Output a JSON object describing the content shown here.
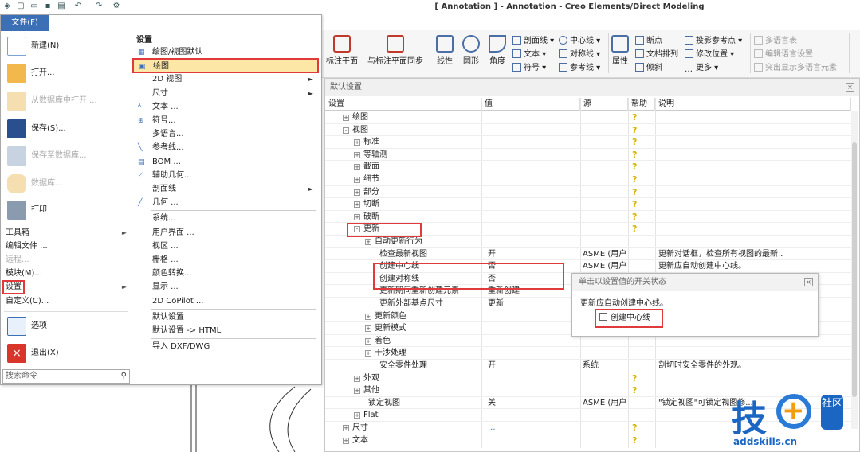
{
  "window": {
    "title": "[ Annotation ] - Annotation - Creo Elements/Direct Modeling"
  },
  "quick_access": [
    "new-icon",
    "open-icon",
    "save-icon",
    "print-icon",
    "undo-icon",
    "redo-icon",
    "options-icon"
  ],
  "file_menu": {
    "tab_label": "文件(F)",
    "big_items": [
      {
        "label": "新建(N)",
        "icon": "new-document-icon",
        "enabled": true
      },
      {
        "label": "打开...",
        "icon": "open-folder-icon",
        "enabled": true
      },
      {
        "label": "从数据库中打开 ...",
        "icon": "db-open-icon",
        "enabled": false
      },
      {
        "label": "保存(S)...",
        "icon": "save-icon",
        "enabled": true
      },
      {
        "label": "保存至数据库...",
        "icon": "db-save-icon",
        "enabled": false
      },
      {
        "label": "数据库...",
        "icon": "database-icon",
        "enabled": false
      },
      {
        "label": "打印",
        "icon": "printer-icon",
        "enabled": true
      }
    ],
    "small_items": [
      {
        "label": "工具箱",
        "submenu": true,
        "enabled": true
      },
      {
        "label": "编辑文件 ...",
        "submenu": false,
        "enabled": true
      },
      {
        "label": "远程...",
        "submenu": false,
        "enabled": false
      },
      {
        "label": "模块(M)...",
        "submenu": false,
        "enabled": true
      },
      {
        "label": "设置",
        "submenu": true,
        "enabled": true
      },
      {
        "label": "自定义(C)...",
        "submenu": false,
        "enabled": true
      }
    ],
    "options_label": "选项",
    "exit_label": "退出(X)",
    "search_placeholder": "搜索命令"
  },
  "settings_menu": {
    "header": "设置",
    "items": [
      {
        "label": "绘图/视图默认",
        "icon": "view-default-icon",
        "submenu": false
      },
      {
        "label": "绘图",
        "icon": "drawing-icon",
        "submenu": false,
        "selected": true
      },
      {
        "label": "2D 视图",
        "submenu": true
      },
      {
        "label": "尺寸",
        "submenu": true
      },
      {
        "label": "文本 ...",
        "icon": "text-icon",
        "submenu": false
      },
      {
        "label": "符号...",
        "icon": "symbol-icon",
        "submenu": false
      },
      {
        "label": "多语言...",
        "submenu": false
      },
      {
        "label": "参考线...",
        "icon": "refline-icon",
        "submenu": false
      },
      {
        "label": "BOM ...",
        "icon": "bom-icon",
        "submenu": false
      },
      {
        "label": "辅助几何...",
        "icon": "aux-geo-icon",
        "submenu": false
      },
      {
        "label": "剖面线",
        "submenu": true
      },
      {
        "label": "几何 ...",
        "icon": "geometry-icon",
        "submenu": false
      },
      {
        "label": "系统...",
        "submenu": false
      },
      {
        "label": "用户界面 ...",
        "submenu": false
      },
      {
        "label": "视区 ...",
        "submenu": false
      },
      {
        "label": "栅格 ...",
        "submenu": false
      },
      {
        "label": "颜色转换...",
        "submenu": false
      },
      {
        "label": "显示 ...",
        "submenu": false
      },
      {
        "label": "2D CoPilot ...",
        "submenu": false
      },
      {
        "label": "默认设置",
        "submenu": false
      },
      {
        "label": "默认设置 -> HTML",
        "submenu": false
      },
      {
        "label": "导入 DXF/DWG",
        "submenu": false
      }
    ]
  },
  "ribbon": {
    "large": [
      {
        "label": "标注平面",
        "icon": "dim-plane-icon"
      },
      {
        "label": "与标注平面同步",
        "icon": "sync-plane-icon"
      },
      {
        "label": "线性",
        "icon": "linear-dim-icon"
      },
      {
        "label": "圆形",
        "icon": "circle-dim-icon"
      },
      {
        "label": "角度",
        "icon": "angle-dim-icon"
      },
      {
        "label": "属性",
        "icon": "properties-icon"
      }
    ],
    "small": [
      {
        "label": "剖面线 ▾",
        "enabled": true
      },
      {
        "label": "文本 ▾",
        "enabled": true
      },
      {
        "label": "符号 ▾",
        "enabled": true
      },
      {
        "label": "中心线 ▾",
        "enabled": true
      },
      {
        "label": "对称线 ▾",
        "enabled": true
      },
      {
        "label": "参考线 ▾",
        "enabled": true
      },
      {
        "label": "断点",
        "enabled": true
      },
      {
        "label": "文档排列",
        "enabled": true
      },
      {
        "label": "倾斜",
        "enabled": true
      },
      {
        "label": "投影参考点 ▾",
        "enabled": true
      },
      {
        "label": "修改位置 ▾",
        "enabled": true
      },
      {
        "label": "更多 ▾",
        "enabled": true
      },
      {
        "label": "多语言表",
        "enabled": false
      },
      {
        "label": "编辑语言设置",
        "enabled": false
      },
      {
        "label": "突出显示多语言元素",
        "enabled": false
      }
    ]
  },
  "panel": {
    "title": "默认设置",
    "columns": [
      "设置",
      "值",
      "源",
      "帮助",
      "说明"
    ],
    "rows": [
      {
        "indent": 1,
        "toggle": "+",
        "name": "绘图",
        "value": "",
        "source": "",
        "help": true,
        "desc": ""
      },
      {
        "indent": 1,
        "toggle": "-",
        "name": "视图",
        "value": "",
        "source": "",
        "help": true,
        "desc": ""
      },
      {
        "indent": 2,
        "toggle": "+",
        "name": "标准",
        "value": "",
        "source": "",
        "help": true,
        "desc": ""
      },
      {
        "indent": 2,
        "toggle": "+",
        "name": "等轴测",
        "value": "",
        "source": "",
        "help": true,
        "desc": ""
      },
      {
        "indent": 2,
        "toggle": "+",
        "name": "截面",
        "value": "",
        "source": "",
        "help": true,
        "desc": ""
      },
      {
        "indent": 2,
        "toggle": "+",
        "name": "细节",
        "value": "",
        "source": "",
        "help": true,
        "desc": ""
      },
      {
        "indent": 2,
        "toggle": "+",
        "name": "部分",
        "value": "",
        "source": "",
        "help": true,
        "desc": ""
      },
      {
        "indent": 2,
        "toggle": "+",
        "name": "切断",
        "value": "",
        "source": "",
        "help": true,
        "desc": ""
      },
      {
        "indent": 2,
        "toggle": "+",
        "name": "破断",
        "value": "",
        "source": "",
        "help": true,
        "desc": ""
      },
      {
        "indent": 2,
        "toggle": "-",
        "name": "更新",
        "value": "",
        "source": "",
        "help": true,
        "desc": ""
      },
      {
        "indent": 3,
        "toggle": "+",
        "name": "自动更新行为",
        "value": "",
        "source": "",
        "help": false,
        "desc": ""
      },
      {
        "indent": 4,
        "toggle": "",
        "name": "检查最新视图",
        "value": "开",
        "source": "ASME (用户)",
        "help": false,
        "desc": "更新对话框，检查所有视图的最新..."
      },
      {
        "indent": 4,
        "toggle": "",
        "name": "创建中心线",
        "value": "否",
        "source": "ASME (用户)",
        "help": false,
        "desc": "更新应自动创建中心线。"
      },
      {
        "indent": 4,
        "toggle": "",
        "name": "创建对称线",
        "value": "否",
        "source": "",
        "help": false,
        "desc": ""
      },
      {
        "indent": 4,
        "toggle": "",
        "name": "更新期间重新创建元素",
        "value": "重新创建",
        "source": "",
        "help": false,
        "desc": ""
      },
      {
        "indent": 4,
        "toggle": "",
        "name": "更新外部基点尺寸",
        "value": "更新",
        "source": "",
        "help": false,
        "desc": ""
      },
      {
        "indent": 3,
        "toggle": "+",
        "name": "更新颜色",
        "value": "",
        "source": "",
        "help": false,
        "desc": ""
      },
      {
        "indent": 3,
        "toggle": "+",
        "name": "更新模式",
        "value": "",
        "source": "",
        "help": false,
        "desc": ""
      },
      {
        "indent": 3,
        "toggle": "+",
        "name": "着色",
        "value": "",
        "source": "",
        "help": false,
        "desc": ""
      },
      {
        "indent": 3,
        "toggle": "+",
        "name": "干涉处理",
        "value": "",
        "source": "",
        "help": false,
        "desc": ""
      },
      {
        "indent": 4,
        "toggle": "",
        "name": "安全零件处理",
        "value": "开",
        "source": "系统",
        "help": false,
        "desc": "剖切时安全零件的外观。"
      },
      {
        "indent": 2,
        "toggle": "+",
        "name": "外观",
        "value": "",
        "source": "",
        "help": true,
        "desc": ""
      },
      {
        "indent": 2,
        "toggle": "+",
        "name": "其他",
        "value": "",
        "source": "",
        "help": true,
        "desc": ""
      },
      {
        "indent": 3,
        "toggle": "",
        "name": "锁定视图",
        "value": "关",
        "source": "ASME (用户)",
        "help": false,
        "desc": "\"锁定视图\"可锁定视图修..."
      },
      {
        "indent": 2,
        "toggle": "+",
        "name": "Flat",
        "value": "",
        "source": "",
        "help": false,
        "desc": ""
      },
      {
        "indent": 1,
        "toggle": "+",
        "name": "尺寸",
        "value": "...",
        "source": "",
        "help": true,
        "desc": ""
      },
      {
        "indent": 1,
        "toggle": "+",
        "name": "文本",
        "value": "",
        "source": "",
        "help": true,
        "desc": ""
      }
    ]
  },
  "tooltip": {
    "title": "单击以设置值的开关状态",
    "description": "更新应自动创建中心线。",
    "checkbox_label": "创建中心线",
    "checked": false
  },
  "logo": {
    "text": "技",
    "badge": "社区",
    "url": "addskills.cn"
  },
  "colors": {
    "accent": "#3b6fb6",
    "highlight": "#e03a3a",
    "selected": "#fde7a7",
    "help_icon": "#d4b400"
  }
}
